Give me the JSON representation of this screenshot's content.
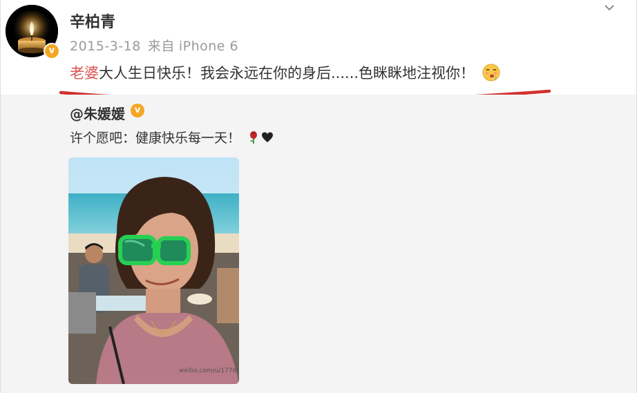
{
  "post": {
    "author_name": "辛柏青",
    "verified_badge": "v",
    "date": "2015-3-18",
    "source_prefix": "来自",
    "device": "iPhone 6",
    "text_highlight": "老婆",
    "text_rest": "大人生日快乐！我会永远在你的身后......色眯眯地注视你！",
    "emoji": "drooling-face-emoji"
  },
  "repost": {
    "author_name": "@朱媛媛",
    "verified_badge": "v",
    "text": "许个愿吧：健康快乐每一天！",
    "icons": [
      "rose-icon",
      "black-heart-icon"
    ],
    "image_watermark": "weibo.com/u/1776869765"
  },
  "colors": {
    "highlight": "#d9534f",
    "underline": "#d32f2f",
    "badge": "#f5a623",
    "repost_bg": "#f4f4f4",
    "meta": "#9a9a9a"
  }
}
